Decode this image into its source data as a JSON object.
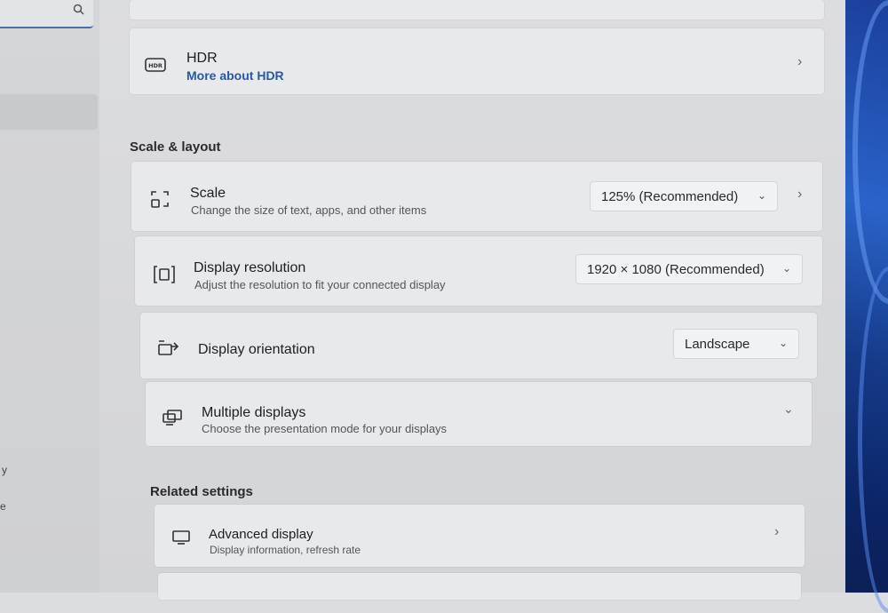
{
  "nav": {
    "search_icon": "search-icon",
    "fragment_1": "y",
    "fragment_2": "e"
  },
  "hdr": {
    "title": "HDR",
    "link": "More about HDR",
    "icon_label": "HDR",
    "chevron": "›"
  },
  "scale_layout": {
    "section_title": "Scale & layout",
    "scale": {
      "title": "Scale",
      "subtitle": "Change the size of text, apps, and other items",
      "value": "125% (Recommended)",
      "chevron": "›"
    },
    "resolution": {
      "title": "Display resolution",
      "subtitle": "Adjust the resolution to fit your connected display",
      "value": "1920 × 1080 (Recommended)"
    },
    "orientation": {
      "title": "Display orientation",
      "value": "Landscape"
    },
    "multiple": {
      "title": "Multiple displays",
      "subtitle": "Choose the presentation mode for your displays"
    }
  },
  "related": {
    "section_title": "Related settings",
    "advanced": {
      "title": "Advanced display",
      "subtitle": "Display information, refresh rate",
      "chevron": "›"
    }
  },
  "glyphs": {
    "dropdown_chevron": "⌄",
    "expand_chevron": "⌄"
  }
}
